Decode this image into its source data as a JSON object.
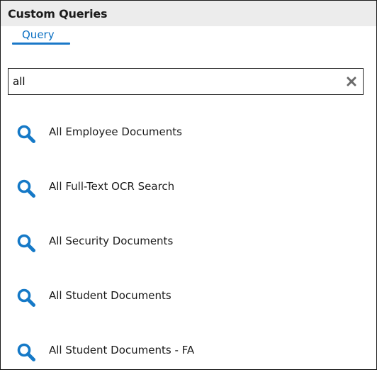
{
  "panel": {
    "title": "Custom Queries"
  },
  "tabs": [
    {
      "label": "Query",
      "active": true
    }
  ],
  "search": {
    "value": "all",
    "placeholder": ""
  },
  "queries": [
    {
      "label": "All Employee Documents",
      "icon": "search-icon"
    },
    {
      "label": "All Full-Text OCR Search",
      "icon": "search-icon"
    },
    {
      "label": "All Security Documents",
      "icon": "search-icon"
    },
    {
      "label": "All Student Documents",
      "icon": "search-icon"
    },
    {
      "label": "All Student Documents - FA",
      "icon": "search-icon"
    }
  ],
  "colors": {
    "accent": "#1a78c8",
    "icon": "#1579c7",
    "header_bg": "#ececec",
    "clear_icon": "#6b6b6b"
  }
}
